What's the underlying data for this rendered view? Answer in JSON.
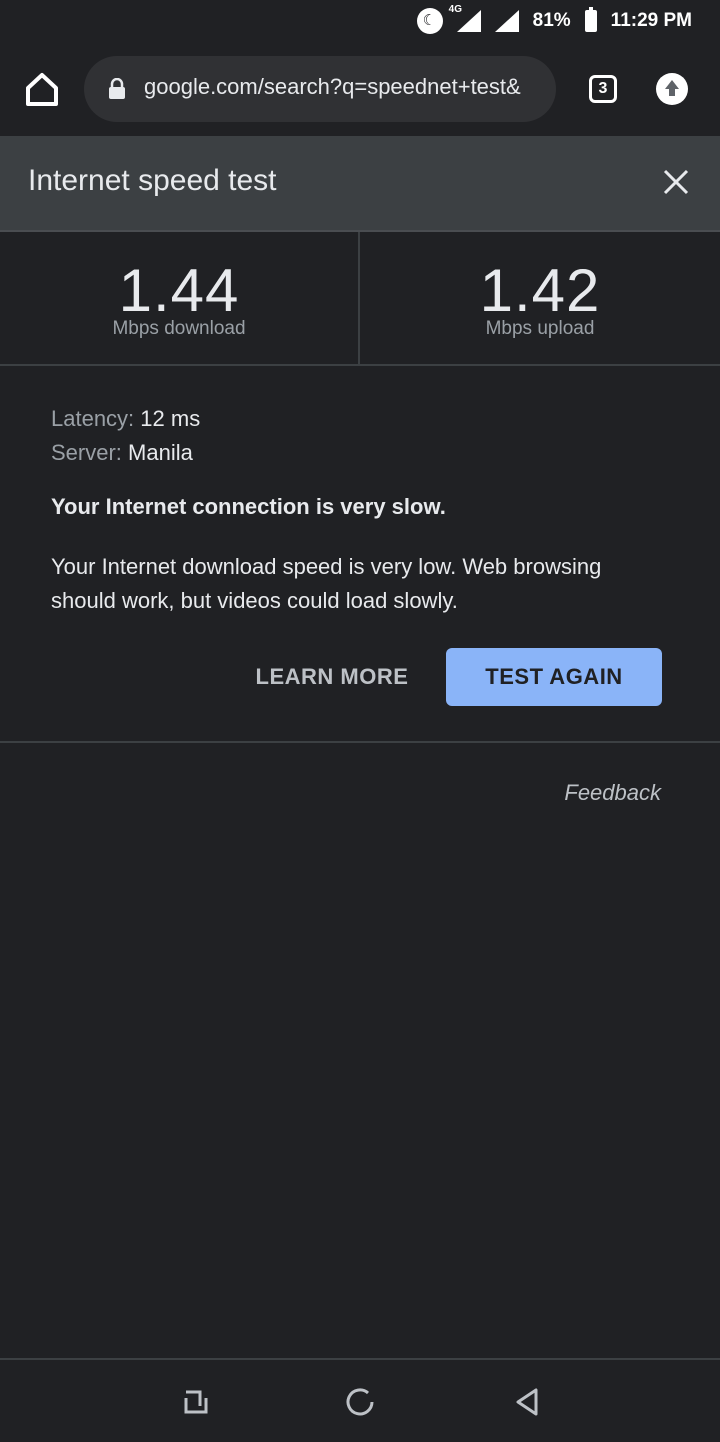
{
  "status_bar": {
    "network": "4G",
    "battery": "81%",
    "time": "11:29 PM"
  },
  "toolbar": {
    "url": "google.com/search?q=speednet+test&",
    "tab_count": "3"
  },
  "card": {
    "title": "Internet speed test",
    "download": {
      "value": "1.44",
      "label": "Mbps download"
    },
    "upload": {
      "value": "1.42",
      "label": "Mbps upload"
    },
    "latency": {
      "label": "Latency:",
      "value": "12 ms"
    },
    "server": {
      "label": "Server:",
      "value": "Manila"
    },
    "headline": "Your Internet connection is very slow.",
    "description": "Your Internet download speed is very low. Web browsing should work, but videos could load slowly.",
    "learn_more_label": "LEARN MORE",
    "test_again_label": "TEST AGAIN",
    "feedback_label": "Feedback"
  },
  "colors": {
    "background": "#202124",
    "header": "#3c4043",
    "accent": "#8ab4f8",
    "text": "#e8eaed",
    "muted_text": "#9aa0a6"
  },
  "icons": {
    "status": [
      "do-not-disturb-icon",
      "signal-icon",
      "signal-icon",
      "battery-icon"
    ],
    "toolbar": [
      "home-icon",
      "lock-icon",
      "tab-switcher-icon",
      "upload-icon"
    ],
    "navigation": [
      "recents-icon",
      "home-circle-icon",
      "back-icon"
    ]
  }
}
